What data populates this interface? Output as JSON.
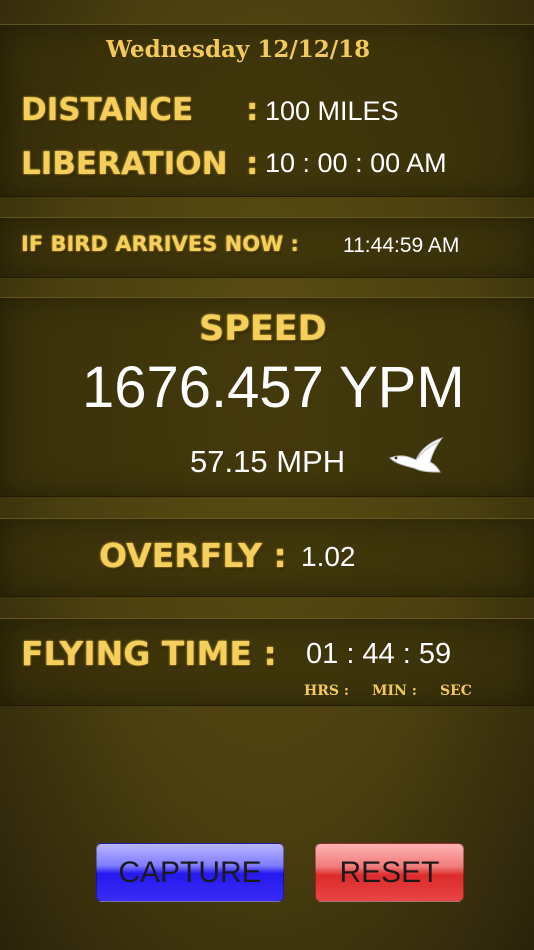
{
  "header": {
    "date": "Wednesday 12/12/18"
  },
  "info": {
    "distance_label": "DISTANCE",
    "distance_value": "100 MILES",
    "liberation_label": "LIBERATION",
    "liberation_value": "10 : 00 : 00 AM",
    "colon": ":"
  },
  "arrival": {
    "label": "IF BIRD ARRIVES NOW :",
    "value": "11:44:59 AM"
  },
  "speed": {
    "label": "SPEED",
    "ypm": "1676.457 YPM",
    "mph": "57.15 MPH"
  },
  "overfly": {
    "label": "OVERFLY :",
    "value": "1.02"
  },
  "flying": {
    "label": "FLYING TIME :",
    "value": "01 : 44 : 59",
    "hrs": "HRS :",
    "min": "MIN :",
    "sec": "SEC"
  },
  "buttons": {
    "capture": "CAPTURE",
    "reset": "RESET"
  }
}
